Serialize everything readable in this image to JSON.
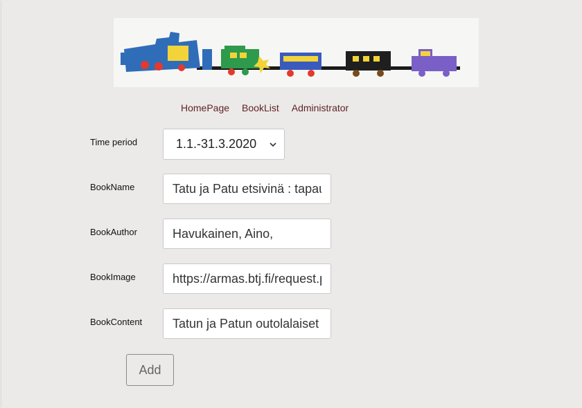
{
  "banner": {
    "alt": "train-banner"
  },
  "nav": {
    "home": "HomePage",
    "booklist": "BookList",
    "admin": "Administrator"
  },
  "form": {
    "time_period": {
      "label": "Time period",
      "selected": "1.1.-31.3.2020"
    },
    "book_name": {
      "label": "BookName",
      "value": "Tatu ja Patu etsivinä : tapau"
    },
    "book_author": {
      "label": "BookAuthor",
      "value": "Havukainen, Aino,"
    },
    "book_image": {
      "label": "BookImage",
      "value": "https://armas.btj.fi/request.p"
    },
    "book_content": {
      "label": "BookContent",
      "value": "Tatun ja Patun outolalaiset ä"
    },
    "add_label": "Add"
  },
  "colors": {
    "background": "#ebeae8",
    "nav_link": "#5e1f24",
    "field_border": "#c9c9c9"
  }
}
